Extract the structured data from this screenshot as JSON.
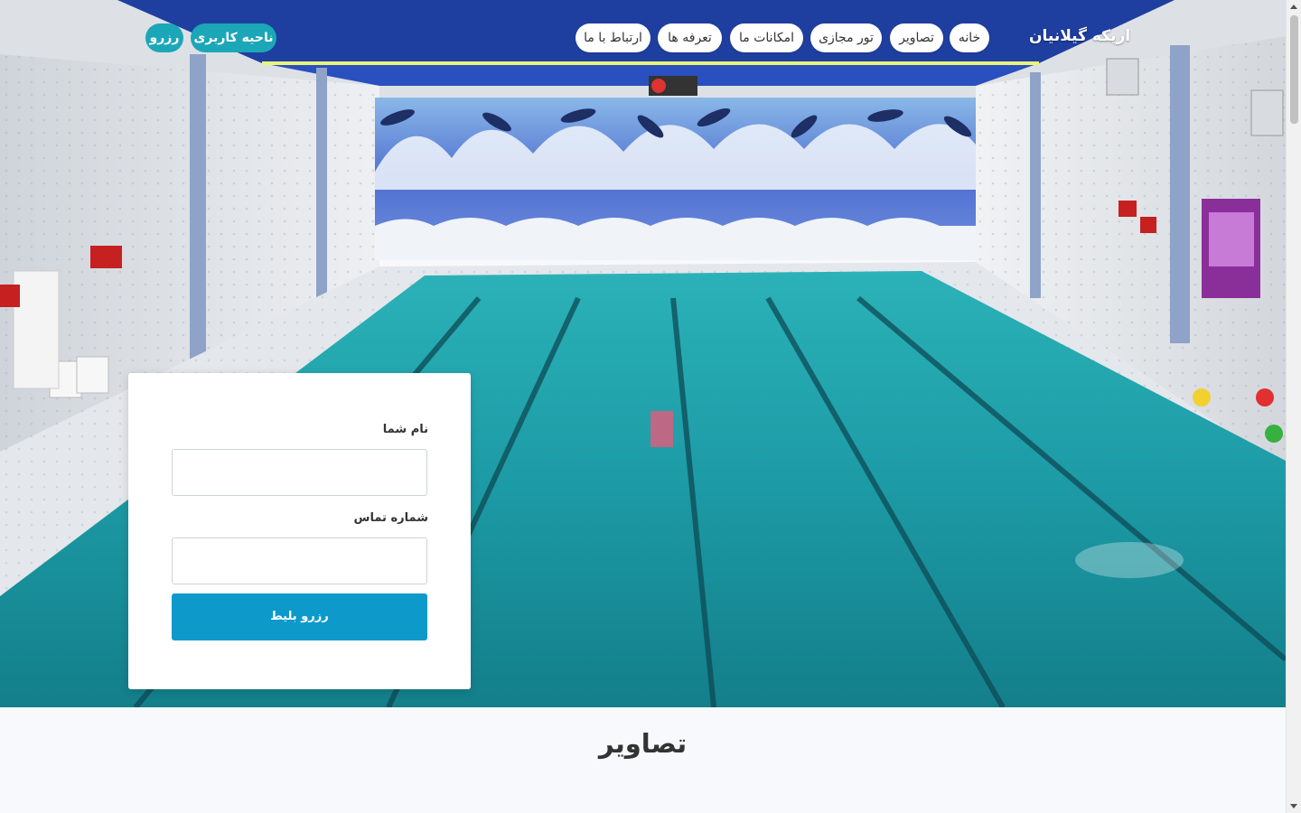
{
  "navbar": {
    "brand": "اریکه گیلانیان",
    "items": [
      {
        "label": "خانه"
      },
      {
        "label": "تصاویر"
      },
      {
        "label": "تور مجازی"
      },
      {
        "label": "امکانات ما"
      },
      {
        "label": "تعرفه ها"
      },
      {
        "label": "ارتباط با ما"
      }
    ],
    "user_area_label": "ناحیه کاربری",
    "reserve_label": "رزرو"
  },
  "hero": {
    "image": "indoor swimming pool with dolphin wave mosaic wall",
    "colors": {
      "ceiling": "#1f3fa0",
      "water": "#1fa0a8",
      "mosaic": "#4a6ad0",
      "tile": "#e6e9ee"
    }
  },
  "booking_form": {
    "name_label": "نام شما",
    "name_value": "",
    "phone_label": "شماره تماس",
    "phone_value": "",
    "submit_label": "رزرو بلیط",
    "accent_color": "#0d9acb"
  },
  "gallery_section": {
    "title": "تصاویر"
  }
}
